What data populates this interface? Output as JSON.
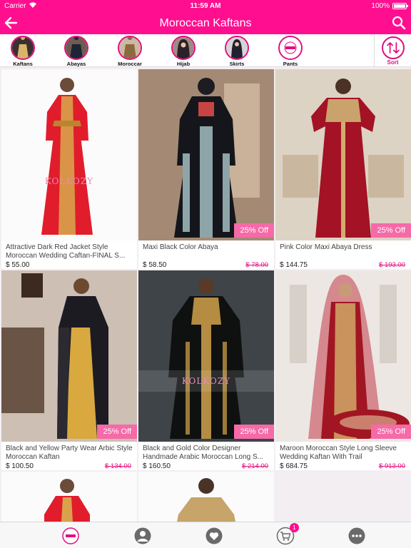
{
  "status": {
    "carrier": "Carrier",
    "time": "11:59 AM",
    "battery": "100%"
  },
  "header": {
    "title": "Moroccan Kaftans"
  },
  "categories": [
    {
      "label": "Kaftans"
    },
    {
      "label": "Abayas"
    },
    {
      "label": "Moroccar"
    },
    {
      "label": "Hijab"
    },
    {
      "label": "Skirts"
    },
    {
      "label": "Pants"
    }
  ],
  "sort": {
    "label": "Sort"
  },
  "products": [
    {
      "name": "Attractive Dark Red Jacket Style Moroccan Wedding Caftan-FINAL S...",
      "price": "$ 55.00",
      "old_price": "",
      "discount": ""
    },
    {
      "name": "Maxi Black Color Abaya",
      "price": "$ 58.50",
      "old_price": "$ 78.00",
      "discount": "25% Off"
    },
    {
      "name": "Pink Color Maxi Abaya Dress",
      "price": "$ 144.75",
      "old_price": "$ 193.00",
      "discount": "25% Off"
    },
    {
      "name": "Black and Yellow Party Wear Arbic Style Moroccan Kaftan",
      "price": "$ 100.50",
      "old_price": "$ 134.00",
      "discount": "25% Off"
    },
    {
      "name": "Black and Gold Color Designer Handmade Arabic  Moroccan Long S...",
      "price": "$ 160.50",
      "old_price": "$ 214.00",
      "discount": "25% Off"
    },
    {
      "name": "Maroon Moroccan Style Long Sleeve Wedding Kaftan With Trail",
      "price": "$ 684.75",
      "old_price": "$ 913.00",
      "discount": "25% Off"
    }
  ],
  "watermark": "KOLKOZY",
  "tabbar": {
    "cart_count": "1"
  },
  "colors": {
    "brand": "#ff0f8f",
    "discount": "#f66aa8",
    "old_price": "#e0107e"
  }
}
